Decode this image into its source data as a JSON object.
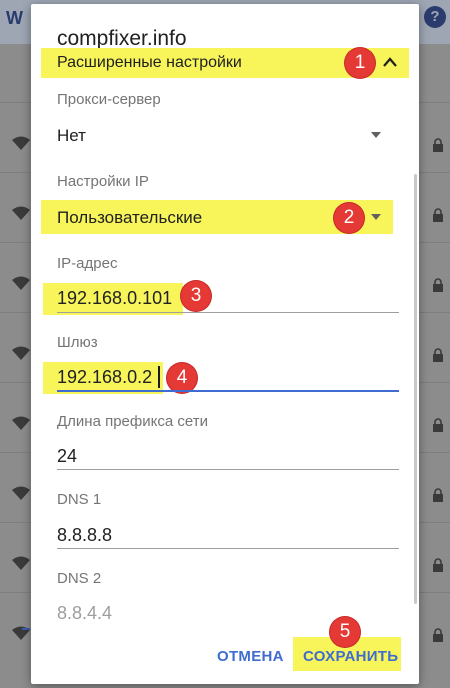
{
  "background": {
    "header_letter": "W",
    "help_glyph": "?"
  },
  "dialog": {
    "title": "compfixer.info",
    "advanced": {
      "label": "Расширенные настройки",
      "badge": "1"
    },
    "proxy": {
      "label": "Прокси-сервер",
      "value": "Нет"
    },
    "ip_settings": {
      "label": "Настройки IP",
      "value": "Пользовательские",
      "badge": "2"
    },
    "ip_address": {
      "label": "IP-адрес",
      "value": "192.168.0.101",
      "badge": "3"
    },
    "gateway": {
      "label": "Шлюз",
      "value": "192.168.0.2",
      "badge": "4"
    },
    "prefix": {
      "label": "Длина префикса сети",
      "value": "24"
    },
    "dns1": {
      "label": "DNS 1",
      "value": "8.8.8.8"
    },
    "dns2": {
      "label": "DNS 2",
      "placeholder": "8.8.4.4"
    },
    "cancel_label": "ОТМЕНА",
    "save_label": "СОХРАНИТЬ",
    "save_badge": "5"
  },
  "colors": {
    "accent": "#3f6cd0",
    "highlight": "#f7f55a",
    "badge": "#e53935"
  },
  "icons": {
    "expand": "chevron-up-icon",
    "dropdown": "dropdown-arrow-icon",
    "wifi": "wifi-icon",
    "lock": "lock-icon"
  }
}
